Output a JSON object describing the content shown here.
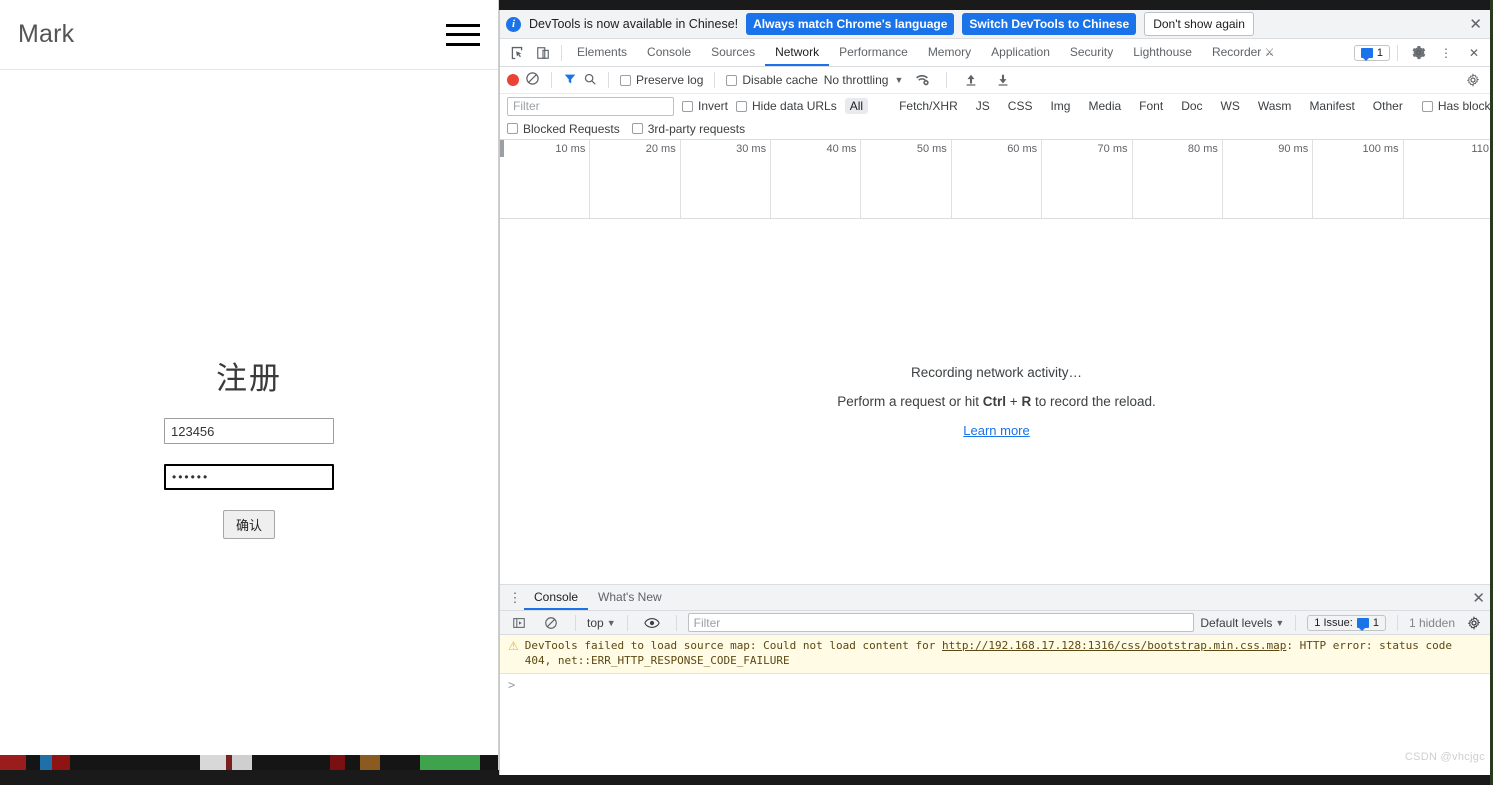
{
  "webpage": {
    "brand": "Mark",
    "menu_icon": "hamburger-icon",
    "form": {
      "title": "注册",
      "username_value": "123456",
      "username_placeholder": "",
      "password_value": "••••••",
      "password_placeholder": "",
      "submit_label": "确认"
    }
  },
  "devtools": {
    "infobar": {
      "message": "DevTools is now available in Chinese!",
      "primary_button": "Always match Chrome's language",
      "secondary_button": "Switch DevTools to Chinese",
      "dismiss_button": "Don't show again",
      "close_icon": "✕"
    },
    "tabs": [
      {
        "label": "Elements",
        "active": false
      },
      {
        "label": "Console",
        "active": false
      },
      {
        "label": "Sources",
        "active": false
      },
      {
        "label": "Network",
        "active": true
      },
      {
        "label": "Performance",
        "active": false
      },
      {
        "label": "Memory",
        "active": false
      },
      {
        "label": "Application",
        "active": false
      },
      {
        "label": "Security",
        "active": false
      },
      {
        "label": "Lighthouse",
        "active": false
      },
      {
        "label": "Recorder",
        "active": false
      }
    ],
    "tabstrip_right": {
      "issues_count": "1",
      "settings_icon": "gear-icon",
      "more_icon": "kebab-icon",
      "close_icon": "close-icon"
    },
    "network_toolbar": {
      "record_title": "record-button",
      "clear_title": "clear-button",
      "filter_title": "filter-icon",
      "search_title": "search-icon",
      "preserve_log": "Preserve log",
      "disable_cache": "Disable cache",
      "throttling": "No throttling",
      "wifi_icon": "network-conditions-icon",
      "import_icon": "import-har-icon",
      "export_icon": "export-har-icon",
      "settings_icon": "gear-icon"
    },
    "filter_row": {
      "filter_placeholder": "Filter",
      "filter_value": "",
      "invert": "Invert",
      "hide_data_urls": "Hide data URLs",
      "types": [
        "All",
        "Fetch/XHR",
        "JS",
        "CSS",
        "Img",
        "Media",
        "Font",
        "Doc",
        "WS",
        "Wasm",
        "Manifest",
        "Other"
      ],
      "selected_type": "All",
      "has_blocked_cookies": "Has blocked cookies"
    },
    "blocked_row": {
      "blocked_requests": "Blocked Requests",
      "third_party_requests": "3rd-party requests"
    },
    "timeline": {
      "ticks": [
        "10 ms",
        "20 ms",
        "30 ms",
        "40 ms",
        "50 ms",
        "60 ms",
        "70 ms",
        "80 ms",
        "90 ms",
        "100 ms",
        "110"
      ]
    },
    "empty_state": {
      "line1": "Recording network activity…",
      "line2_prefix": "Perform a request or hit ",
      "line2_key1": "Ctrl",
      "line2_plus": " + ",
      "line2_key2": "R",
      "line2_suffix": " to record the reload.",
      "link": "Learn more"
    },
    "drawer": {
      "tabs": [
        {
          "label": "Console",
          "active": true
        },
        {
          "label": "What's New",
          "active": false
        }
      ],
      "close_icon": "✕",
      "toolbar": {
        "sidebar_icon": "console-sidebar-icon",
        "clear_icon": "clear-console-icon",
        "context": "top",
        "eye_icon": "live-expression-icon",
        "filter_placeholder": "Filter",
        "filter_value": "",
        "levels": "Default levels",
        "issues": "1 Issue:",
        "issues_count": "1",
        "hidden": "1 hidden",
        "settings_icon": "gear-icon"
      },
      "messages": [
        {
          "severity": "warning",
          "text_before": "DevTools failed to load source map: Could not load content for ",
          "link": "http://192.168.17.128:1316/css/bootstrap.min.css.map",
          "text_after": ": HTTP error: status code 404, net::ERR_HTTP_RESPONSE_CODE_FAILURE"
        }
      ],
      "prompt_symbol": ">"
    }
  },
  "watermark": "CSDN @vhcjgc"
}
